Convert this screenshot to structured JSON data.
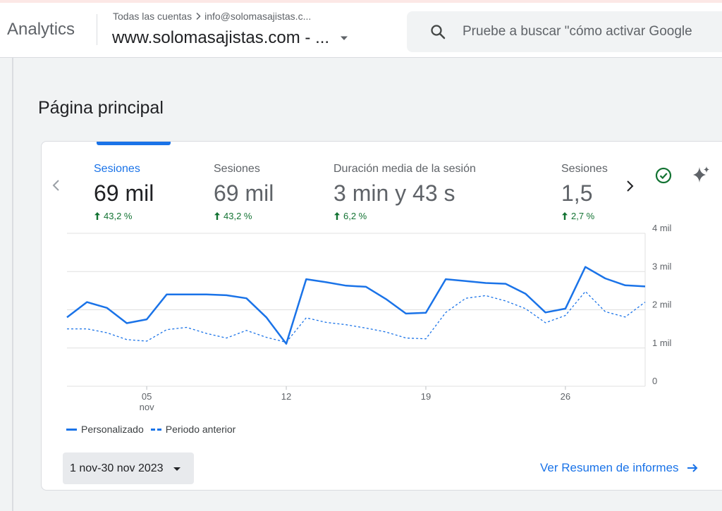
{
  "header": {
    "brand": "Analytics",
    "account_path": "Todas las cuentas",
    "account_email": "info@solomasajistas.c...",
    "property_name": "www.solomasajistas.com - ...",
    "search_placeholder": "Pruebe a buscar \"cómo activar Google"
  },
  "page": {
    "title": "Página principal"
  },
  "metrics": [
    {
      "label": "Sesiones",
      "value": "69 mil",
      "change": "43,2 %",
      "active": true
    },
    {
      "label": "Sesiones",
      "value": "69 mil",
      "change": "43,2 %",
      "active": false
    },
    {
      "label": "Duración media de la sesión",
      "value": "3 min y 43 s",
      "change": "6,2 %",
      "active": false
    },
    {
      "label": "Sesiones",
      "value": "1,5",
      "change": "2,7 %",
      "active": false
    }
  ],
  "legend": {
    "current": "Personalizado",
    "previous": "Periodo anterior"
  },
  "footer": {
    "date_range": "1 nov-30 nov 2023",
    "report_link": "Ver Resumen de informes"
  },
  "colors": {
    "accent": "#1a73e8",
    "positive": "#137333"
  },
  "chart_data": {
    "type": "line",
    "x": [
      1,
      2,
      3,
      4,
      5,
      6,
      7,
      8,
      9,
      10,
      11,
      12,
      13,
      14,
      15,
      16,
      17,
      18,
      19,
      20,
      21,
      22,
      23,
      24,
      25,
      26,
      27,
      28,
      29,
      30
    ],
    "x_ticks": [
      {
        "day": 5,
        "label": "05",
        "sublabel": "nov"
      },
      {
        "day": 12,
        "label": "12",
        "sublabel": ""
      },
      {
        "day": 19,
        "label": "19",
        "sublabel": ""
      },
      {
        "day": 26,
        "label": "26",
        "sublabel": ""
      }
    ],
    "y_ticks": [
      {
        "value": 0,
        "label": "0"
      },
      {
        "value": 1000,
        "label": "1 mil"
      },
      {
        "value": 2000,
        "label": "2 mil"
      },
      {
        "value": 3000,
        "label": "3 mil"
      },
      {
        "value": 4000,
        "label": "4 mil"
      }
    ],
    "ylim": [
      0,
      4000
    ],
    "series": [
      {
        "name": "Personalizado",
        "style": "solid",
        "values": [
          1800,
          2200,
          2050,
          1650,
          1750,
          2400,
          2400,
          2400,
          2380,
          2300,
          1800,
          1110,
          2800,
          2720,
          2630,
          2600,
          2280,
          1900,
          1920,
          2800,
          2750,
          2700,
          2680,
          2420,
          1930,
          2030,
          3120,
          2820,
          2640,
          2610
        ]
      },
      {
        "name": "Periodo anterior",
        "style": "dashed",
        "values": [
          1500,
          1500,
          1400,
          1220,
          1180,
          1480,
          1540,
          1380,
          1260,
          1460,
          1280,
          1150,
          1790,
          1670,
          1610,
          1520,
          1420,
          1260,
          1240,
          1930,
          2300,
          2370,
          2230,
          2030,
          1660,
          1850,
          2480,
          1950,
          1810,
          2200
        ]
      }
    ]
  }
}
